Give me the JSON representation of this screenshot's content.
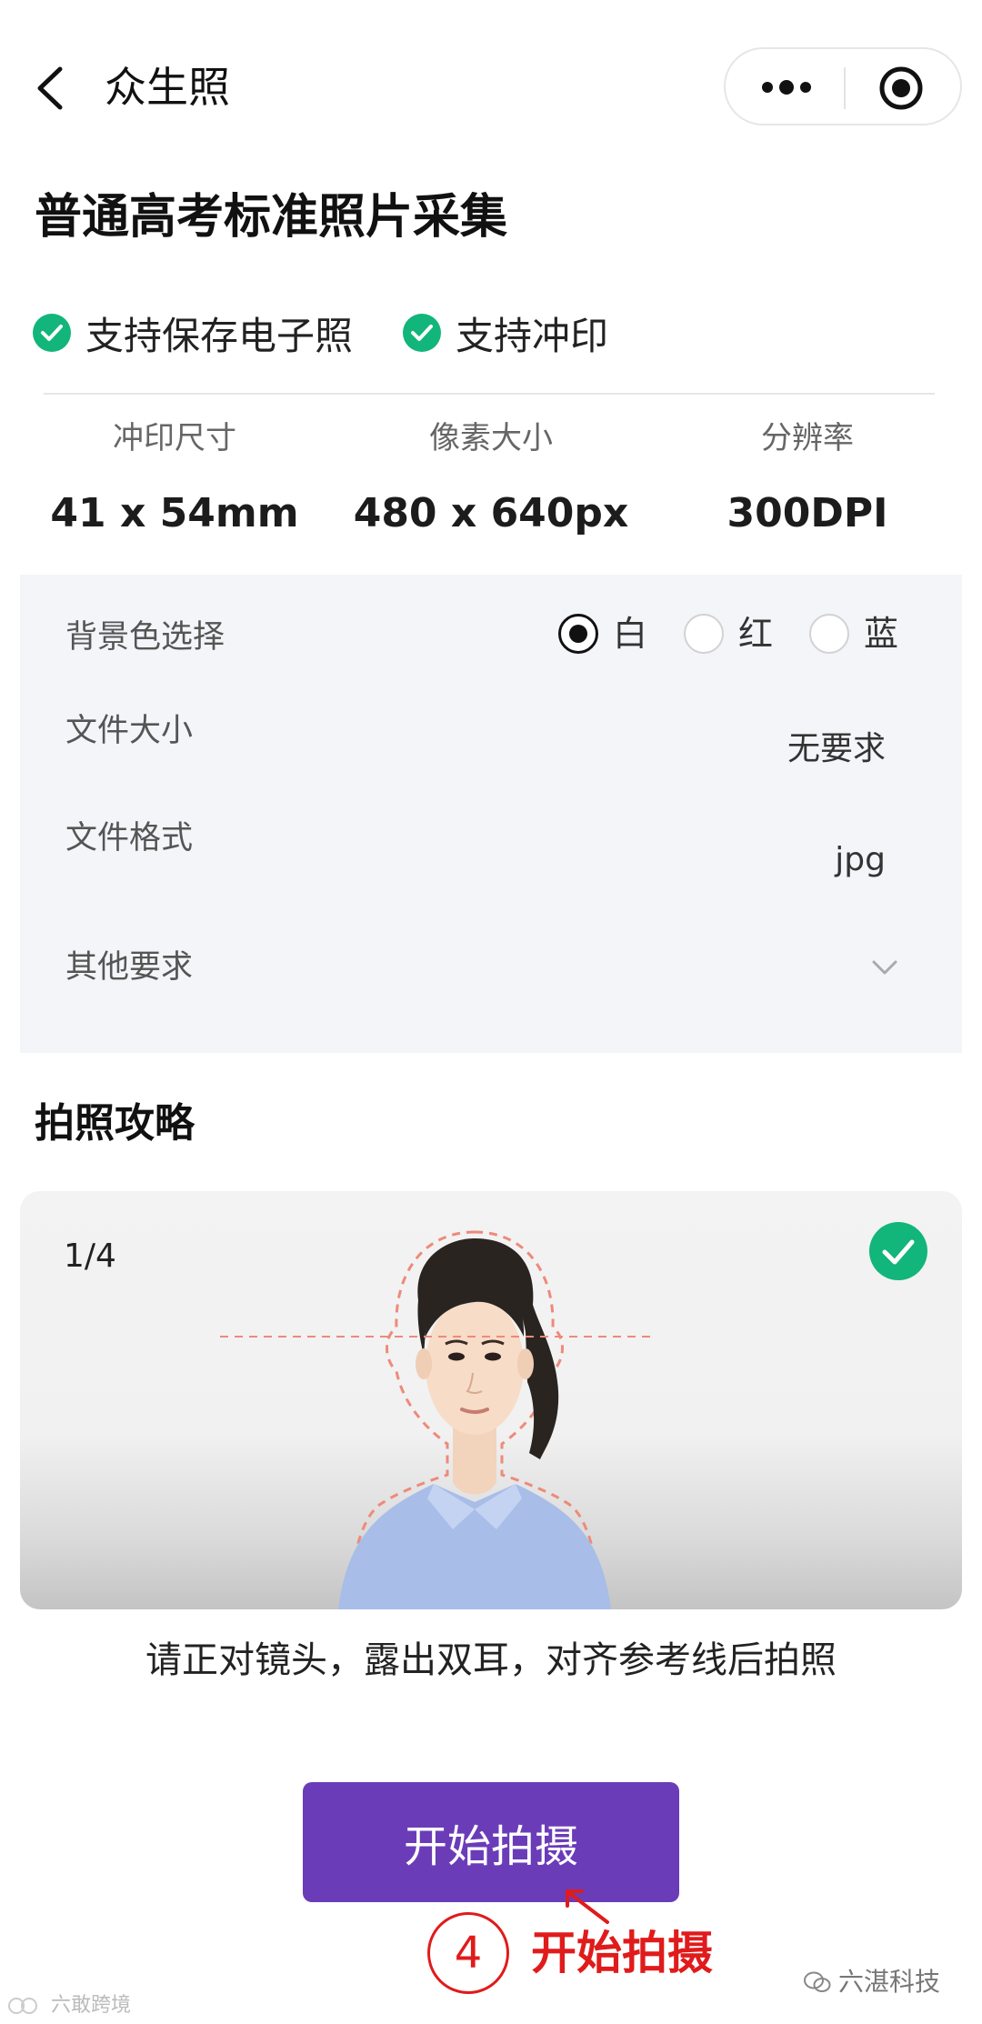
{
  "nav": {
    "title": "众生照"
  },
  "page_title": "普通高考标准照片采集",
  "features": [
    "支持保存电子照",
    "支持冲印"
  ],
  "specs": [
    {
      "label": "冲印尺寸",
      "value": "41 x 54mm"
    },
    {
      "label": "像素大小",
      "value": "480 x 640px"
    },
    {
      "label": "分辨率",
      "value": "300DPI"
    }
  ],
  "options": {
    "background": {
      "label": "背景色选择",
      "choices": [
        {
          "label": "白",
          "selected": true
        },
        {
          "label": "红",
          "selected": false
        },
        {
          "label": "蓝",
          "selected": false
        }
      ]
    },
    "file_size": {
      "label": "文件大小",
      "value": "无要求"
    },
    "file_format": {
      "label": "文件格式",
      "value": "jpg"
    },
    "other": {
      "label": "其他要求"
    }
  },
  "guide": {
    "title": "拍照攻略",
    "counter": "1/4",
    "tip": "请正对镜头，露出双耳，对齐参考线后拍照"
  },
  "start_button": "开始拍摄",
  "annotation": {
    "step": "4",
    "label": "开始拍摄",
    "color": "#e01b1b"
  },
  "watermarks": {
    "right": "六湛科技",
    "left": "六敢跨境"
  },
  "colors": {
    "accent": "#6b3cb8",
    "check": "#12b57a",
    "panel": "#f4f5f8"
  }
}
